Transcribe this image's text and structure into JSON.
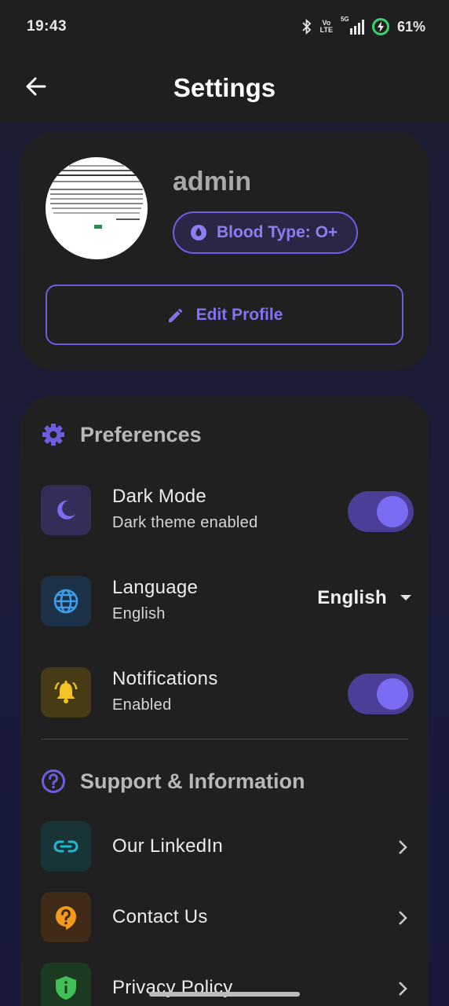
{
  "status_bar": {
    "time": "19:43",
    "battery": "61%",
    "network": "5G",
    "volte_top": "Vo",
    "volte_bottom": "LTE",
    "icons": [
      "bluetooth-icon",
      "volte-icon",
      "signal-icon",
      "battery-charging-icon"
    ]
  },
  "app_bar": {
    "title": "Settings",
    "back_icon": "arrow-left-icon"
  },
  "profile": {
    "username": "admin",
    "blood_type_label": "Blood Type: O+",
    "edit_label": "Edit Profile"
  },
  "preferences": {
    "heading": "Preferences",
    "items": [
      {
        "title": "Dark Mode",
        "subtitle": "Dark theme enabled",
        "icon": "moon-icon",
        "control": "toggle",
        "on": true
      },
      {
        "title": "Language",
        "subtitle": "English",
        "icon": "globe-icon",
        "control": "dropdown",
        "value": "English"
      },
      {
        "title": "Notifications",
        "subtitle": "Enabled",
        "icon": "bell-icon",
        "control": "toggle",
        "on": true
      }
    ]
  },
  "support": {
    "heading": "Support & Information",
    "items": [
      {
        "title": "Our LinkedIn",
        "icon": "link-icon"
      },
      {
        "title": "Contact Us",
        "icon": "help-bubble-icon"
      },
      {
        "title": "Privacy Policy",
        "icon": "shield-icon"
      }
    ]
  },
  "colors": {
    "accent": "#7b6cf4",
    "card": "#202021",
    "background": "#1a1c38"
  }
}
